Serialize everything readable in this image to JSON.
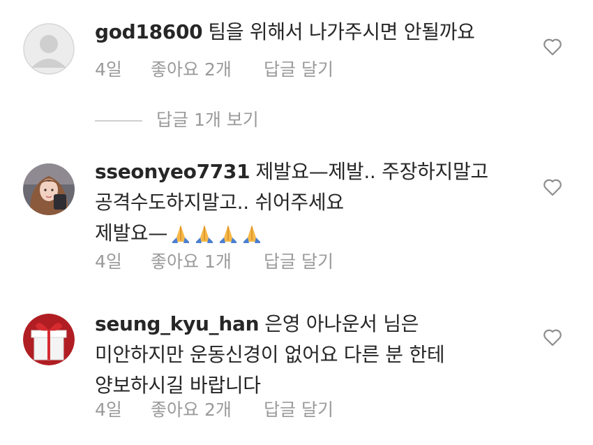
{
  "comments": [
    {
      "username": "god18600",
      "lines": [
        "팀을 위해서 나가주시면 안될까요"
      ],
      "time": "4일",
      "likes": "좋아요 2개",
      "reply": "답글 달기",
      "avatar": "default-avatar-icon"
    },
    {
      "username": "sseonyeo7731",
      "lines": [
        "제발요—제발.. 주장하지말고",
        "공격수도하지말고.. 쉬어주세요",
        "제발요—"
      ],
      "emoji": "folded-hands-icon",
      "emoji_count": 4,
      "time": "4일",
      "likes": "좋아요 1개",
      "reply": "답글 달기",
      "avatar": "profile-photo"
    },
    {
      "username": "seung_kyu_han",
      "lines": [
        "은영 아나운서 님은",
        "미안하지만 운동신경이 없어요 다른 분 한테",
        "양보하시길 바랍니다"
      ],
      "time": "4일",
      "likes": "좋아요 2개",
      "reply": "답글 달기",
      "avatar": "gift-box-icon"
    }
  ],
  "view_replies": "답글 1개 보기",
  "colors": {
    "meta": "#9a9a9a",
    "text": "#262626",
    "divider": "#cfcfcf"
  }
}
